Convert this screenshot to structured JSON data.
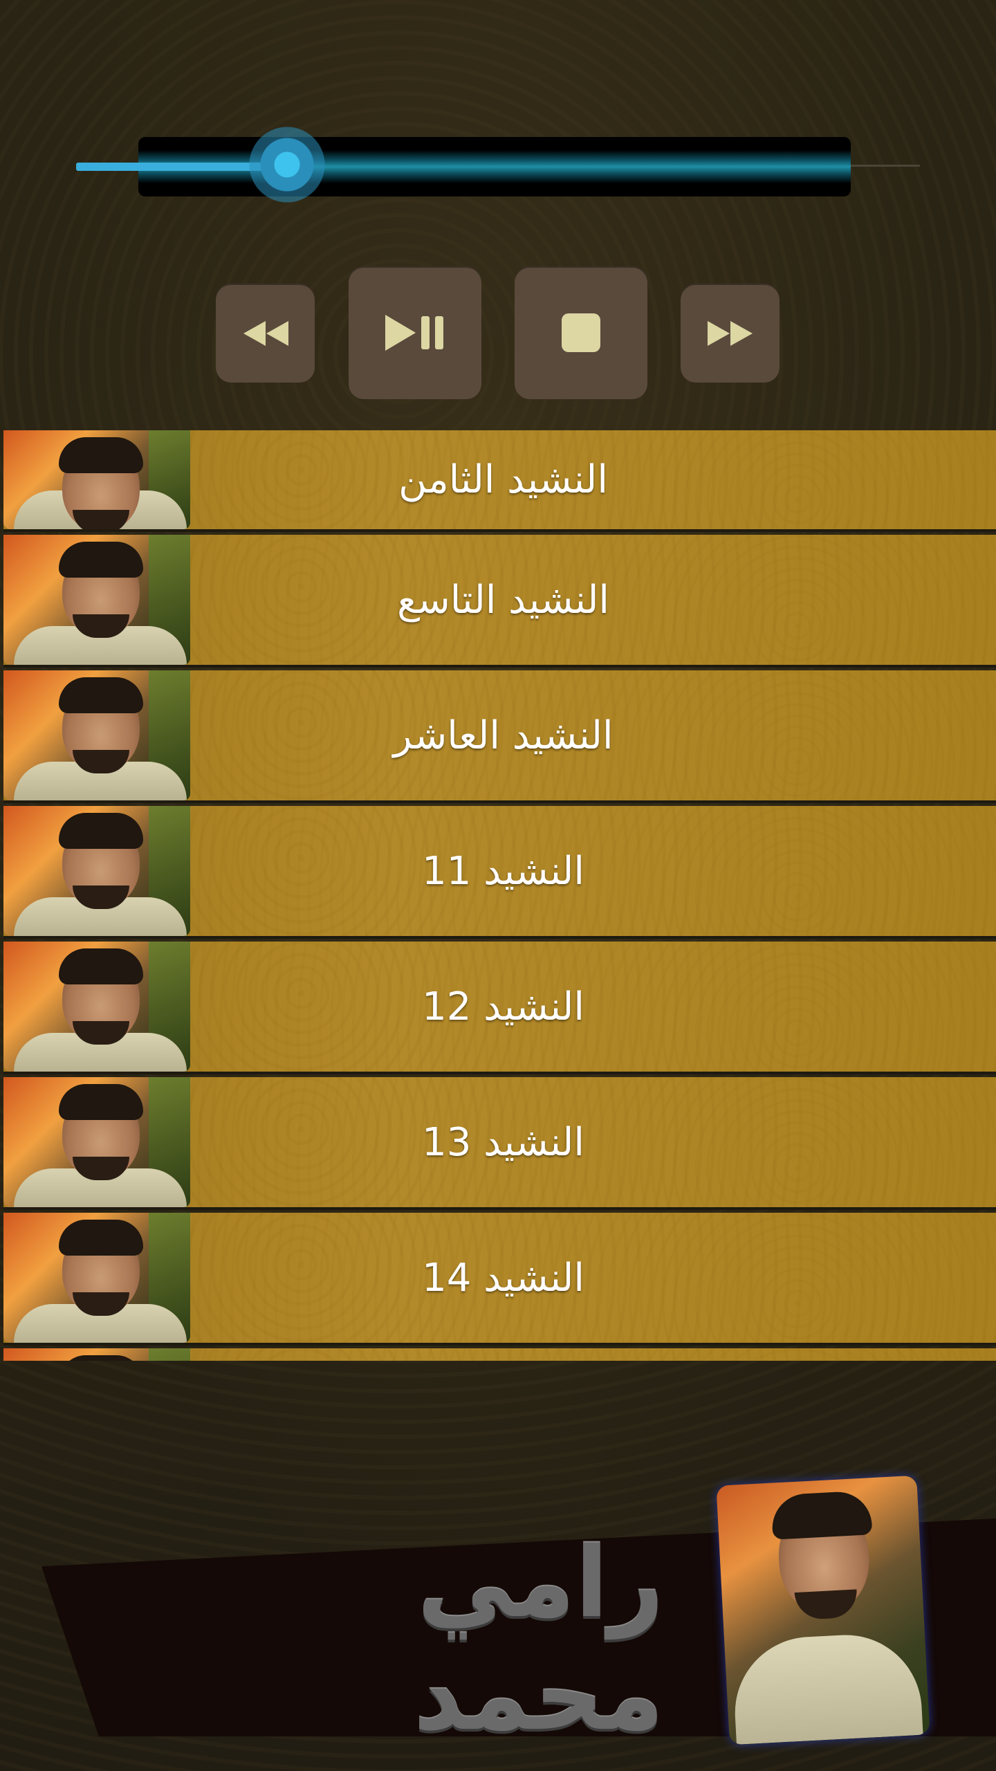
{
  "player": {
    "seek": {
      "progress_fraction": 0.25
    },
    "controls": [
      {
        "id": "rewind",
        "icon": "rewind-icon"
      },
      {
        "id": "play_pause",
        "icon": "play-pause-icon"
      },
      {
        "id": "stop",
        "icon": "stop-icon"
      },
      {
        "id": "fast_forward",
        "icon": "fast-forward-icon"
      }
    ]
  },
  "tracks": [
    {
      "title": "النشيد الثامن"
    },
    {
      "title": "النشيد التاسع"
    },
    {
      "title": "النشيد العاشر"
    },
    {
      "title": "النشيد 11"
    },
    {
      "title": "النشيد 12"
    },
    {
      "title": "النشيد 13"
    },
    {
      "title": "النشيد 14"
    },
    {
      "title": ""
    }
  ],
  "banner": {
    "artist_name": "رامي محمد"
  },
  "colors": {
    "accent": "#3aaedc",
    "button": "#5a4a3c",
    "button_icon": "#dcd7a3",
    "list_row": "#a8801f"
  }
}
